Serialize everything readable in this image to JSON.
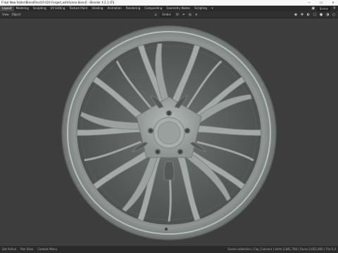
{
  "window": {
    "title": "F:\\kol New folder\\BlendFiles\\SY-024 Forged_withScene.blend] - Blender 4.2.1 LTS",
    "controls": [
      "—",
      "☐",
      "✕"
    ]
  },
  "topbar": {
    "tabs": [
      "Layout",
      "Modeling",
      "Sculpting",
      "UV Editing",
      "Texture Paint",
      "Shading",
      "Animation",
      "Rendering",
      "Compositing",
      "Geometry Nodes",
      "Scripting",
      "+"
    ],
    "scene_label": "Scene"
  },
  "viewport_header": {
    "menus": [
      "View",
      "Object"
    ],
    "orientation": "Global"
  },
  "status": {
    "left_items": [
      "Set Active",
      "Pan View",
      "Context Menu"
    ],
    "right_text": "Scene collection | Cap_Connect | Verts:2,841,768 | Faces:2,661,800 | Tris:5,4"
  }
}
